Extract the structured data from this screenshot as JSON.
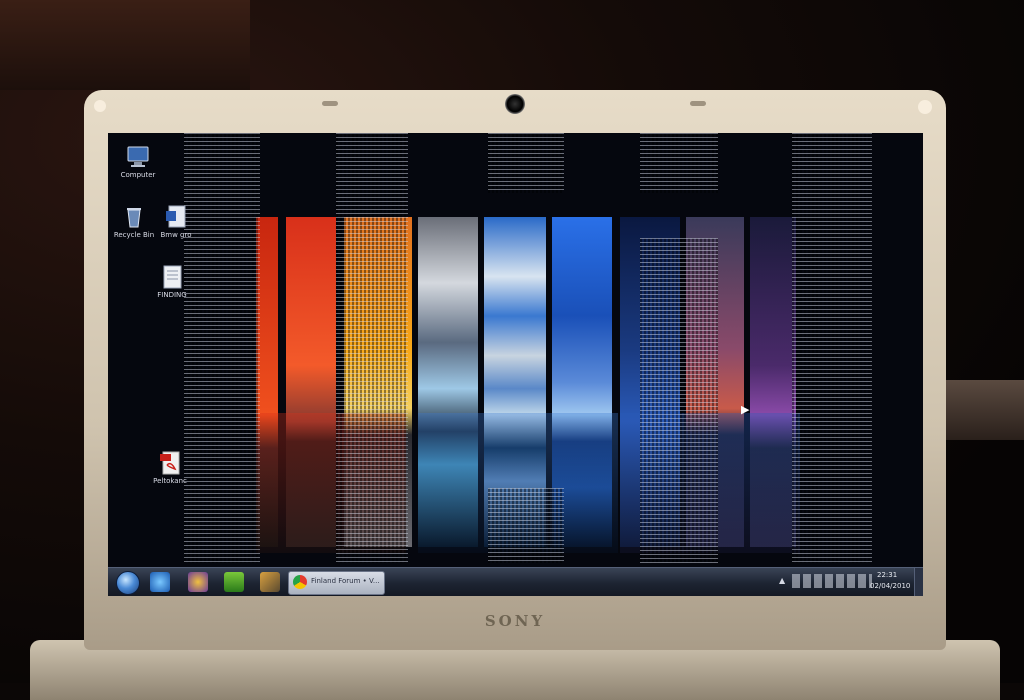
{
  "bezel": {
    "brand": "SONY"
  },
  "desktop": {
    "icons": [
      {
        "label": "Computer",
        "icon": "computer-icon"
      },
      {
        "label": "Recycle Bin",
        "icon": "recycle-bin-icon"
      },
      {
        "label": "Bmw gro",
        "icon": "document-icon"
      },
      {
        "label": "FINDING",
        "icon": "document-icon"
      },
      {
        "label": "Peltokanc",
        "icon": "pdf-icon"
      }
    ]
  },
  "taskbar": {
    "active_window": "Finland Forum • V...",
    "pinned": [
      "internet-explorer-icon",
      "messenger-icon",
      "utorrent-icon",
      "tools-icon"
    ],
    "tray_arrow": "▲",
    "clock_time": "22:31",
    "clock_date": "02/04/2010"
  },
  "colors": {
    "taskbar": "#1d2432",
    "bezel": "#e7dcc8",
    "accent_blue": "#4a8ad6"
  }
}
